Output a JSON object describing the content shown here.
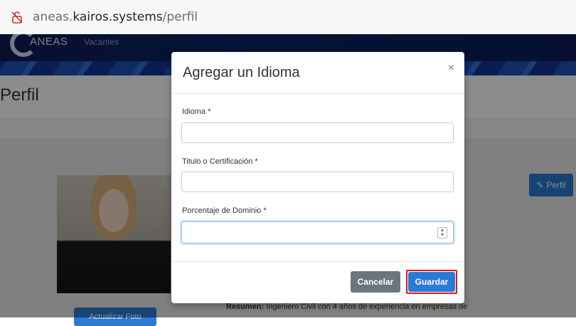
{
  "browser": {
    "url_prefix": "aneas.",
    "url_domain": "kairos.systems",
    "url_path": "/perfil"
  },
  "navbar": {
    "brand": "ANEAS",
    "link": "Vacantes"
  },
  "page": {
    "title": "Perfil",
    "upload_button": "Actualizar Foto",
    "perfil_button": "Perfil",
    "resumen_label": "Resumen:",
    "resumen_text": " Ingeniero Civil con 4 años de experiencia en empresas de"
  },
  "modal": {
    "title": "Agregar un Idioma",
    "close": "×",
    "fields": [
      {
        "label": "Idioma *",
        "value": ""
      },
      {
        "label": "Titulo o Certificación *",
        "value": ""
      },
      {
        "label": "Porcentaje de Dominio *",
        "value": ""
      }
    ],
    "cancel_label": "Cancelar",
    "save_label": "Guardar"
  },
  "colors": {
    "primary": "#2b7bd6",
    "secondary": "#6c757d",
    "highlight": "#e3111b",
    "navbar": "#0c1c54"
  }
}
